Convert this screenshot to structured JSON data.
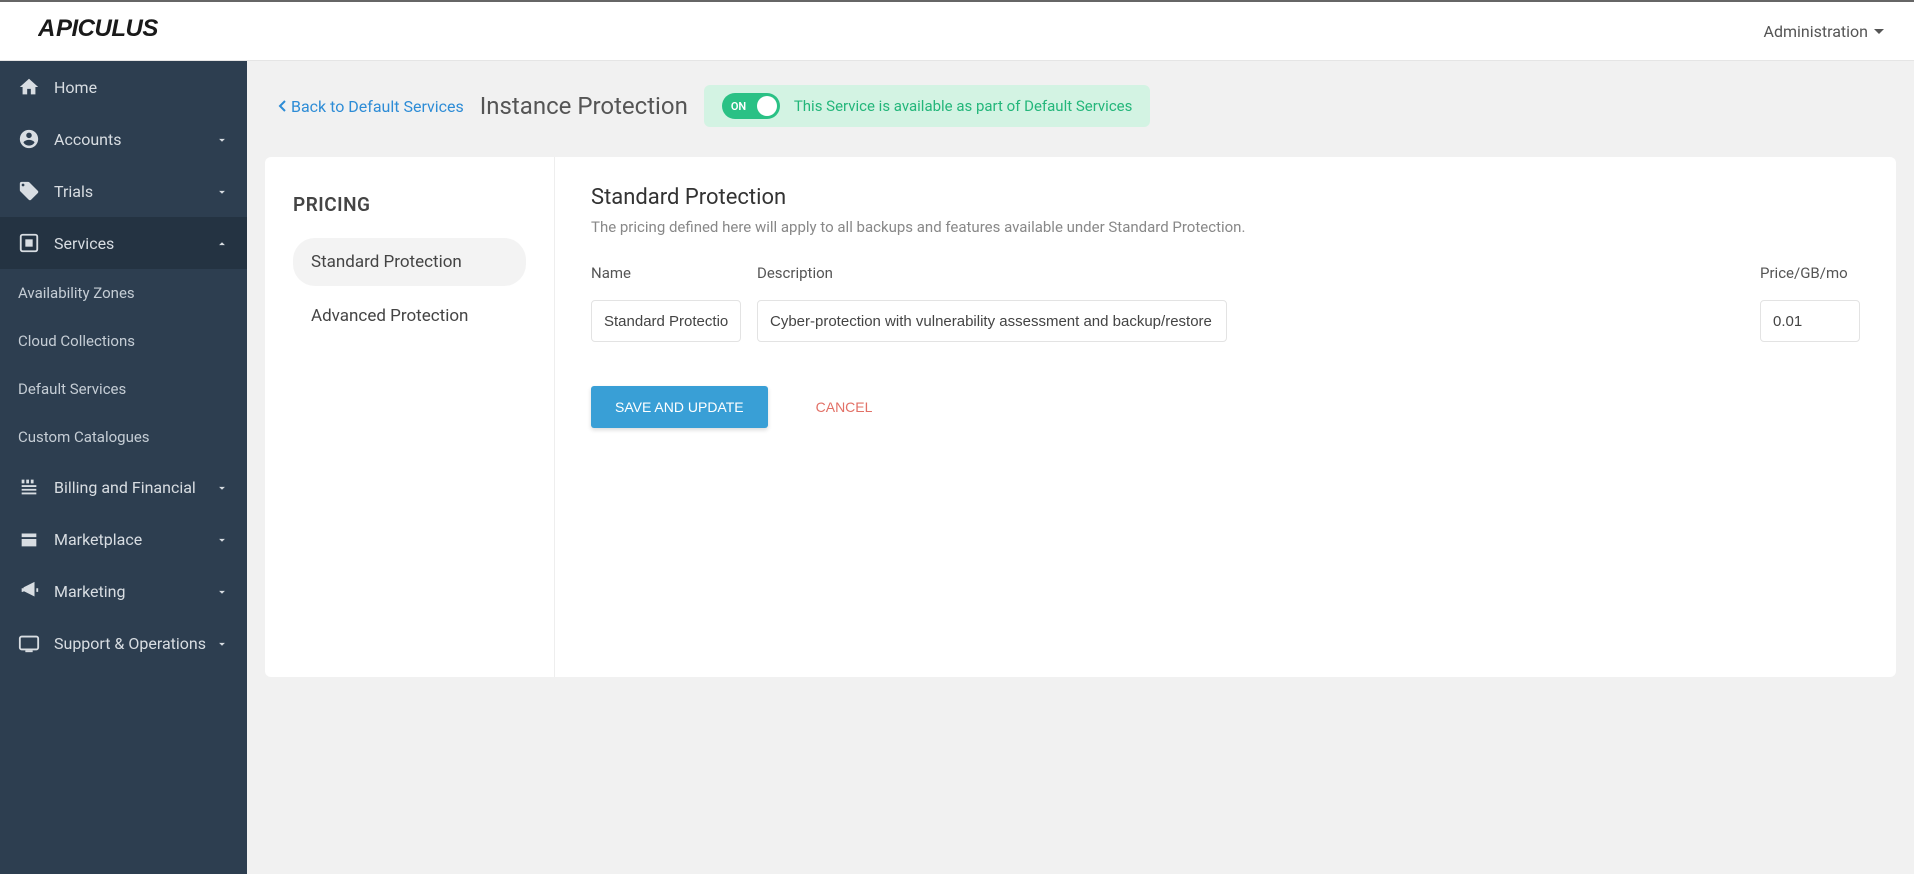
{
  "header": {
    "logo": "APICULUS",
    "adminLink": "Administration"
  },
  "sidebar": {
    "items": [
      {
        "label": "Home",
        "icon": "home",
        "expandable": false
      },
      {
        "label": "Accounts",
        "icon": "account",
        "expandable": true
      },
      {
        "label": "Trials",
        "icon": "tag",
        "expandable": true
      },
      {
        "label": "Services",
        "icon": "services",
        "expandable": true,
        "expanded": true,
        "children": [
          {
            "label": "Availability Zones"
          },
          {
            "label": "Cloud Collections"
          },
          {
            "label": "Default Services"
          },
          {
            "label": "Custom Catalogues"
          }
        ]
      },
      {
        "label": "Billing and Financial",
        "icon": "billing",
        "expandable": true
      },
      {
        "label": "Marketplace",
        "icon": "marketplace",
        "expandable": true
      },
      {
        "label": "Marketing",
        "icon": "marketing",
        "expandable": true
      },
      {
        "label": "Support & Operations",
        "icon": "support",
        "expandable": true
      }
    ]
  },
  "page": {
    "backLink": "Back to Default Services",
    "title": "Instance Protection",
    "toggleLabel": "ON",
    "bannerText": "This Service is available as part of Default Services"
  },
  "pricing": {
    "sidebarTitle": "PRICING",
    "tabs": [
      {
        "label": "Standard Protection",
        "active": true
      },
      {
        "label": "Advanced Protection",
        "active": false
      }
    ],
    "section": {
      "title": "Standard Protection",
      "description": "The pricing defined here will apply to all backups and features available under Standard Protection."
    },
    "columns": {
      "name": "Name",
      "description": "Description",
      "price": "Price/GB/mo"
    },
    "row": {
      "name": "Standard Protection",
      "description": "Cyber-protection with vulnerability assessment and backup/restore se",
      "price": "0.01"
    },
    "buttons": {
      "save": "SAVE AND UPDATE",
      "cancel": "CANCEL"
    }
  }
}
